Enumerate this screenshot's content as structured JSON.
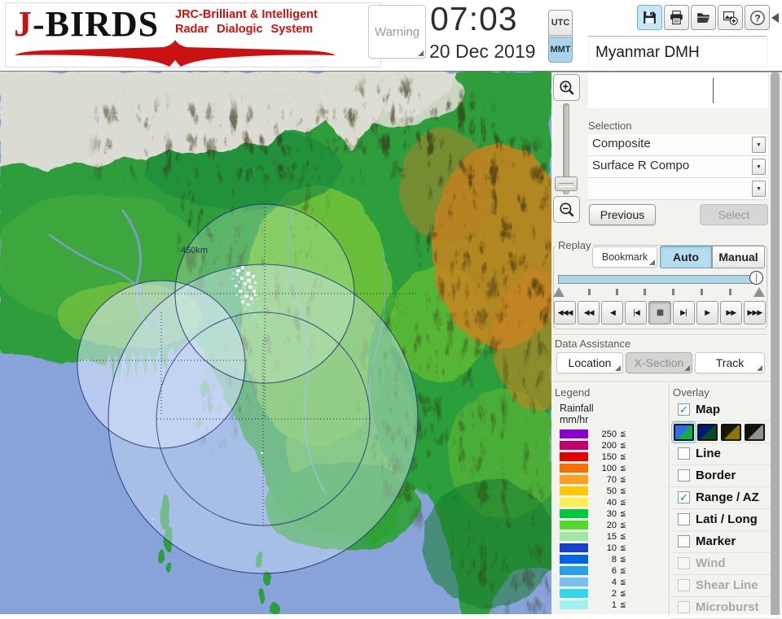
{
  "header": {
    "logo": {
      "title_accent": "J",
      "title_rest": "-BIRDS",
      "tagline_line1": "JRC-Brilliant & Intelligent",
      "tagline_line2": "Radar Dialogic System",
      "brand_color": "#cc1111"
    },
    "warning_button": "Warning",
    "clock": {
      "time": "07:03",
      "date": "20 Dec 2019"
    },
    "timezone": {
      "utc": "UTC",
      "mmt": "MMT",
      "selected": "MMT",
      "selected_color": "#a9d4ea"
    },
    "toolbar_icons": [
      "save-icon",
      "print-icon",
      "open-folder-icon",
      "add-image-icon",
      "help-icon"
    ],
    "toolbar_active_icon": "save-icon",
    "station": "Myanmar DMH"
  },
  "map": {
    "range_ring_label": "450km"
  },
  "panel": {
    "selection": {
      "label": "Selection",
      "combo1": "Composite",
      "combo2": "Surface R Compo",
      "combo3": ""
    },
    "previous_button": "Previous",
    "select_button": "Select",
    "replay": {
      "label": "Replay",
      "bookmark_button": "Bookmark",
      "auto_button": "Auto",
      "manual_button": "Manual",
      "mode_selected": "Auto",
      "slider_position_pct": 100,
      "transport": [
        {
          "name": "rewind-start-button",
          "glyph": "◀◀◀",
          "active": false
        },
        {
          "name": "fast-rewind-button",
          "glyph": "◀◀",
          "active": false
        },
        {
          "name": "play-reverse-button",
          "glyph": "◀",
          "active": false
        },
        {
          "name": "step-back-button",
          "glyph": "|◀",
          "active": false
        },
        {
          "name": "stop-button",
          "glyph": "■",
          "active": true
        },
        {
          "name": "step-forward-button",
          "glyph": "▶|",
          "active": false
        },
        {
          "name": "play-button",
          "glyph": "▶",
          "active": false
        },
        {
          "name": "fast-forward-button",
          "glyph": "▶▶",
          "active": false
        },
        {
          "name": "forward-end-button",
          "glyph": "▶▶▶",
          "active": false
        }
      ]
    },
    "data_assistance": {
      "label": "Data Assistance",
      "buttons": [
        {
          "label": "Location",
          "enabled": true
        },
        {
          "label": "X-Section",
          "enabled": false
        },
        {
          "label": "Track",
          "enabled": true
        }
      ]
    },
    "legend": {
      "label": "Legend",
      "title_line1": "Rainfall",
      "title_line2": "mm/hr",
      "lte_symbol": "≦",
      "rows": [
        {
          "value": "250",
          "color": "#8a00cc"
        },
        {
          "value": "200",
          "color": "#c4006e"
        },
        {
          "value": "150",
          "color": "#e80000"
        },
        {
          "value": "100",
          "color": "#fa6e00"
        },
        {
          "value": "70",
          "color": "#ffa020"
        },
        {
          "value": "50",
          "color": "#ffc800"
        },
        {
          "value": "40",
          "color": "#ffee50"
        },
        {
          "value": "30",
          "color": "#00c83c"
        },
        {
          "value": "20",
          "color": "#50dc28"
        },
        {
          "value": "15",
          "color": "#a0e8a0"
        },
        {
          "value": "10",
          "color": "#1840d0"
        },
        {
          "value": "8",
          "color": "#0064e8"
        },
        {
          "value": "6",
          "color": "#28a0e8"
        },
        {
          "value": "4",
          "color": "#78c0f0"
        },
        {
          "value": "2",
          "color": "#30d8f0"
        },
        {
          "value": "1",
          "color": "#a0f0f0"
        }
      ]
    },
    "overlay": {
      "label": "Overlay",
      "items": [
        {
          "label": "Map",
          "checked": true,
          "enabled": true
        },
        {
          "label": "Line",
          "checked": false,
          "enabled": true
        },
        {
          "label": "Border",
          "checked": false,
          "enabled": true
        },
        {
          "label": "Range / AZ",
          "checked": true,
          "enabled": true
        },
        {
          "label": "Lati / Long",
          "checked": false,
          "enabled": true
        },
        {
          "label": "Marker",
          "checked": false,
          "enabled": true
        },
        {
          "label": "Wind",
          "checked": false,
          "enabled": false
        },
        {
          "label": "Shear Line",
          "checked": false,
          "enabled": false
        },
        {
          "label": "Microburst",
          "checked": false,
          "enabled": false
        }
      ],
      "map_styles": [
        {
          "name": "map-style-blue-green",
          "color_top": "#2e6fe8",
          "color_bottom": "#18a848",
          "selected": true
        },
        {
          "name": "map-style-navy-darkgreen",
          "color_top": "#001878",
          "color_bottom": "#0a4a20",
          "selected": false
        },
        {
          "name": "map-style-black-olive",
          "color_top": "#181800",
          "color_bottom": "#8a7800",
          "selected": false
        },
        {
          "name": "map-style-black-gray",
          "color_top": "#101010",
          "color_bottom": "#909090",
          "selected": false
        }
      ]
    }
  }
}
